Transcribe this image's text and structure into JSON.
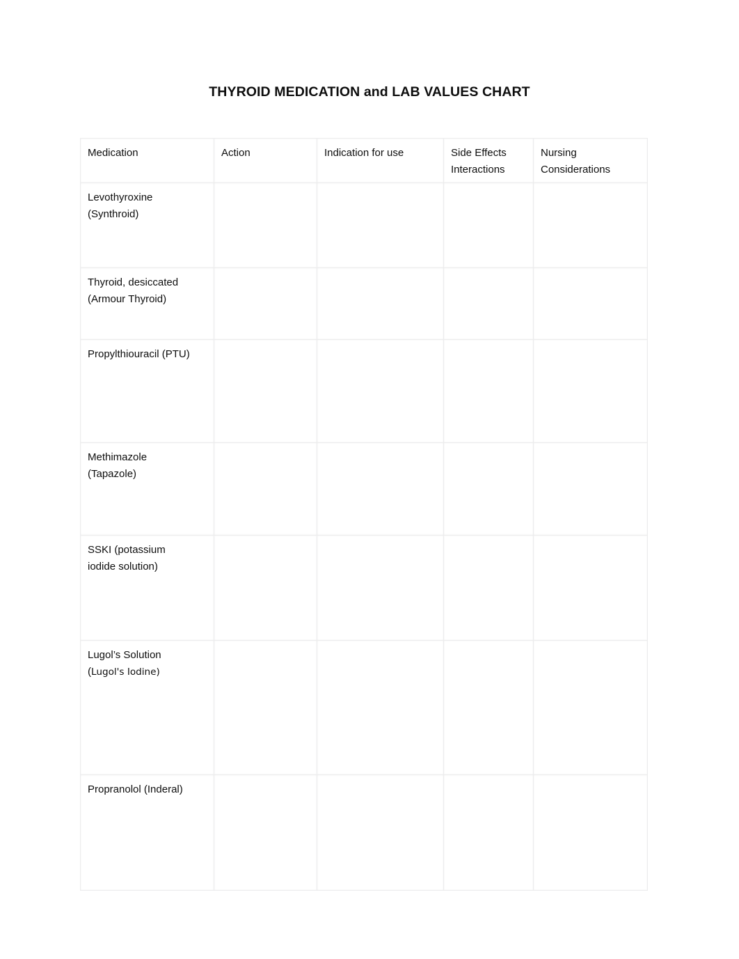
{
  "document": {
    "title": "THYROID MEDICATION and LAB VALUES CHART",
    "background_color": "#ffffff",
    "text_color": "#0d0d0d",
    "border_color": "#ececed"
  },
  "table": {
    "name": "thyroid-medication-lab-values-table",
    "columns": [
      {
        "key": "medication",
        "header": "Medication"
      },
      {
        "key": "action",
        "header": "Action"
      },
      {
        "key": "indication",
        "header": "Indication for use"
      },
      {
        "key": "side_effects",
        "header": "Side Effects\nInteractions"
      },
      {
        "key": "nursing",
        "header": "Nursing\nConsiderations"
      }
    ],
    "rows": [
      {
        "medication": "Levothyroxine\n(Synthroid)",
        "action": "",
        "indication": "",
        "side_effects": "",
        "nursing": ""
      },
      {
        "medication": "Thyroid, desiccated\n(Armour Thyroid)",
        "action": "",
        "indication": "",
        "side_effects": "",
        "nursing": ""
      },
      {
        "medication": "Propylthiouracil (PTU)",
        "action": "",
        "indication": "",
        "side_effects": "",
        "nursing": ""
      },
      {
        "medication": "Methimazole\n(Tapazole)",
        "action": "",
        "indication": "",
        "side_effects": "",
        "nursing": ""
      },
      {
        "medication": "SSKI (potassium\niodide solution)",
        "action": "",
        "indication": "",
        "side_effects": "",
        "nursing": ""
      },
      {
        "medication_line1": "Lugol’s Solution",
        "medication_line2_paren": "(",
        "medication_line2": "Lugol's Iodine)",
        "action": "",
        "indication": "",
        "side_effects": "",
        "nursing": ""
      },
      {
        "medication": "Propranolol (Inderal)",
        "action": "",
        "indication": "",
        "side_effects": "",
        "nursing": ""
      }
    ]
  }
}
